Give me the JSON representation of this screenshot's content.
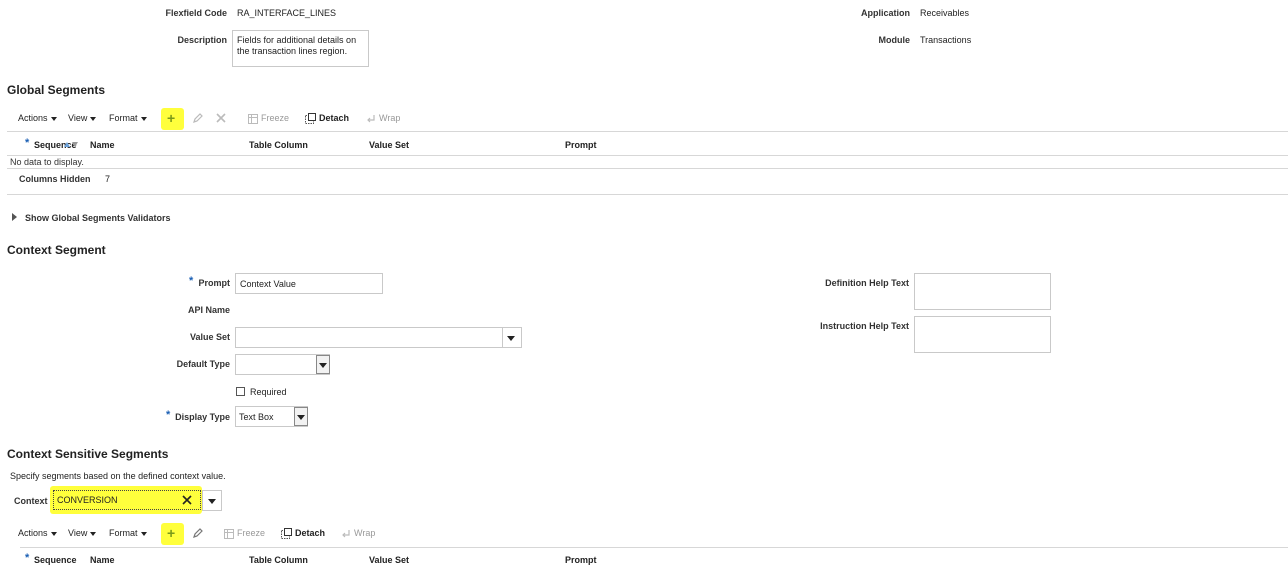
{
  "header": {
    "flexfield_code_label": "Flexfield Code",
    "flexfield_code_value": "RA_INTERFACE_LINES",
    "description_label": "Description",
    "description_value": "Fields for additional details on the transaction lines region.",
    "application_label": "Application",
    "application_value": "Receivables",
    "module_label": "Module",
    "module_value": "Transactions"
  },
  "global_segments": {
    "title": "Global Segments",
    "toolbar": {
      "actions": "Actions",
      "view": "View",
      "format": "Format",
      "freeze": "Freeze",
      "detach": "Detach",
      "wrap": "Wrap"
    },
    "columns": [
      "Sequence",
      "Name",
      "Table Column",
      "Value Set",
      "Prompt"
    ],
    "empty_text": "No data to display.",
    "columns_hidden_label": "Columns Hidden",
    "columns_hidden_value": "7",
    "validators_label": "Show Global Segments Validators"
  },
  "context_segment": {
    "title": "Context Segment",
    "prompt_label": "Prompt",
    "prompt_value": "Context Value",
    "api_name_label": "API Name",
    "value_set_label": "Value Set",
    "value_set_value": "",
    "default_type_label": "Default Type",
    "default_type_value": "",
    "required_label": "Required",
    "display_type_label": "Display Type",
    "display_type_value": "Text Box",
    "definition_help_label": "Definition Help Text",
    "instruction_help_label": "Instruction Help Text"
  },
  "context_sensitive": {
    "title": "Context Sensitive Segments",
    "instruction": "Specify segments based on the defined context value.",
    "context_label": "Context",
    "context_value": "CONVERSION",
    "toolbar": {
      "actions": "Actions",
      "view": "View",
      "format": "Format",
      "freeze": "Freeze",
      "detach": "Detach",
      "wrap": "Wrap"
    },
    "columns": [
      "Sequence",
      "Name",
      "Table Column",
      "Value Set",
      "Prompt"
    ]
  },
  "colors": {
    "highlight": "#ffff3c",
    "required_star": "#1a5fb4",
    "add_icon": "#7a9a1a"
  }
}
